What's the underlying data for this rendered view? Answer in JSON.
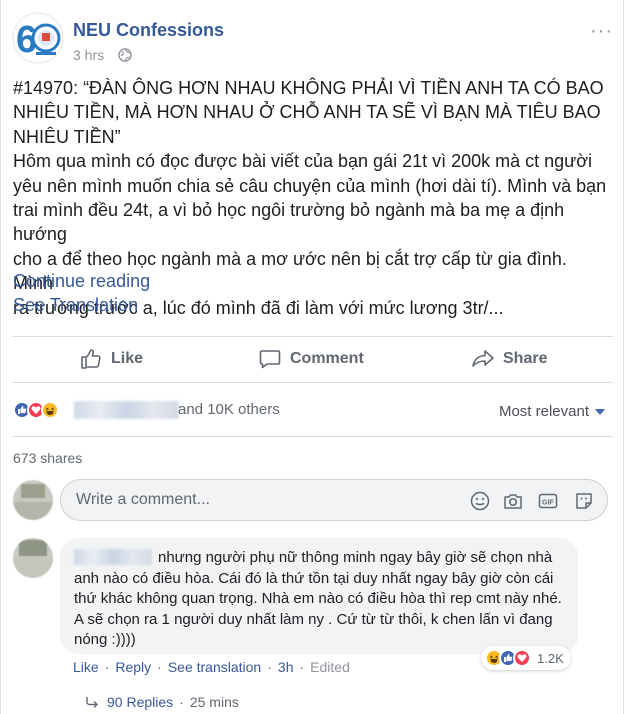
{
  "post": {
    "page_name": "NEU Confessions",
    "time": "3 hrs",
    "more": "···",
    "text_lines": [
      "#14970: “ĐÀN ÔNG HƠN NHAU KHÔNG PHẢI VÌ TIỀN ANH TA CÓ BAO",
      "NHIÊU TIỀN, MÀ HƠN NHAU Ở CHỖ ANH TA SẼ VÌ BẠN MÀ TIÊU BAO",
      "NHIÊU TIỀN”",
      "Hôm qua mình có đọc được bài viết của bạn gái 21t vì 200k mà ct người",
      "yêu nên mình muốn chia sẻ câu chuyện của mình (hơi dài tí). Mình và bạn",
      "trai mình đều 24t, a vì bỏ học ngôi trường bỏ ngành mà ba mẹ a định hướng",
      "cho a để theo học ngành mà a mơ ước nên bị cắt trợ cấp từ gia đình. Mình",
      "ra trường trước a, lúc đó mình đã đi làm với mức lương 3tr/..."
    ],
    "continue_reading": "Continue reading",
    "see_translation": "See Translation"
  },
  "actions": {
    "like": "Like",
    "comment": "Comment",
    "share": "Share"
  },
  "reactions": {
    "others": "and 10K others",
    "sort": "Most relevant",
    "shares": "673 shares"
  },
  "comment_box": {
    "placeholder": "Write a comment..."
  },
  "comment": {
    "text": "nhưng người phụ nữ thông minh ngay bây giờ sẽ chọn nhà anh nào có điều hòa. Cái đó là thứ tồn tại duy nhất ngay bây giờ còn cái thứ khác không quan trọng. Nhà em nào có điều hòa thì rep cmt này nhé. A sẽ chọn ra 1 người duy nhất làm ny . Cứ từ từ thôi, k chen lấn vì đang nóng :))))",
    "like": "Like",
    "reply": "Reply",
    "see_translation": "See translation",
    "time": "3h",
    "edited": "Edited",
    "reaction_count": "1.2K",
    "replies": "90 Replies",
    "replies_time": "25 mins"
  },
  "colors": {
    "link": "#365899",
    "like_blue": "#4267b2",
    "love_red": "#f33e58",
    "haha_yellow": "#f7b928"
  }
}
